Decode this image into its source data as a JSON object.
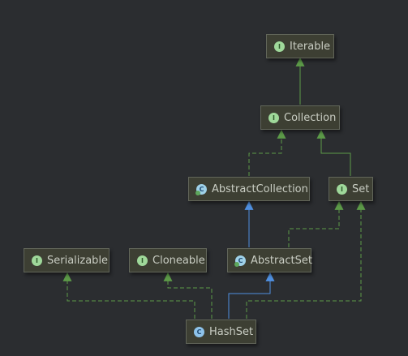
{
  "nodes": [
    {
      "id": "iterable",
      "label": "Iterable",
      "kind": "interface",
      "badge": "I"
    },
    {
      "id": "collection",
      "label": "Collection",
      "kind": "interface",
      "badge": "I"
    },
    {
      "id": "abstractcollection",
      "label": "AbstractCollection",
      "kind": "abstract",
      "badge": "C"
    },
    {
      "id": "set",
      "label": "Set",
      "kind": "interface",
      "badge": "I"
    },
    {
      "id": "serializable",
      "label": "Serializable",
      "kind": "interface",
      "badge": "I"
    },
    {
      "id": "cloneable",
      "label": "Cloneable",
      "kind": "interface",
      "badge": "I"
    },
    {
      "id": "abstractset",
      "label": "AbstractSet",
      "kind": "abstract",
      "badge": "C"
    },
    {
      "id": "hashset",
      "label": "HashSet",
      "kind": "class",
      "badge": "C"
    }
  ],
  "edges": [
    {
      "from": "collection",
      "to": "iterable",
      "type": "interface-extends"
    },
    {
      "from": "abstractcollection",
      "to": "collection",
      "type": "implements"
    },
    {
      "from": "set",
      "to": "collection",
      "type": "interface-extends"
    },
    {
      "from": "abstractset",
      "to": "abstractcollection",
      "type": "extends"
    },
    {
      "from": "abstractset",
      "to": "set",
      "type": "implements"
    },
    {
      "from": "hashset",
      "to": "abstractset",
      "type": "extends"
    },
    {
      "from": "hashset",
      "to": "set",
      "type": "implements"
    },
    {
      "from": "hashset",
      "to": "serializable",
      "type": "implements"
    },
    {
      "from": "hashset",
      "to": "cloneable",
      "type": "implements"
    }
  ],
  "colors": {
    "background": "#2b2d30",
    "node_fill": "#3d3f33",
    "node_border": "#62665a",
    "node_text": "#c9cdc3",
    "green_edge": "#5c9a48",
    "blue_edge": "#4f8fe0"
  }
}
